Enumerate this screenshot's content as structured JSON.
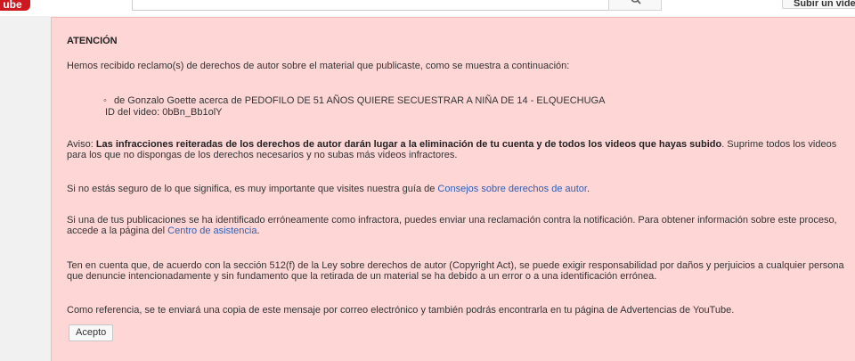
{
  "header": {
    "logo_text": "ube",
    "upload_label": "Subir un vídeo"
  },
  "notice": {
    "heading": "ATENCIÓN",
    "intro": "Hemos recibido reclamo(s) de derechos de autor sobre el material que publicaste, como se muestra a continuación:",
    "claim": "de Gonzalo Goette acerca de PEDOFILO DE 51  AÑOS QUIERE SECUESTRAR A NIÑA DE 14 - ELQUECHUGA",
    "video_id": "ID del video: 0bBn_Bb1olY",
    "warning_prefix": "Aviso: ",
    "warning_bold": "Las infracciones reiteradas de los derechos de autor darán lugar a la eliminación de tu cuenta y de todos los videos que hayas subido",
    "warning_rest": ". Suprime todos los videos para los que no dispongas de los derechos necesarios y no subas más videos infractores.",
    "unsure_text": "Si no estás seguro de lo que significa, es muy importante que visites nuestra guía de ",
    "unsure_link": "Consejos sobre derechos de autor",
    "unsure_end": ".",
    "dispute_text": "Si una de tus publicaciones se ha identificado erróneamente como infractora, puedes enviar una reclamación contra la notificación. Para obtener información sobre este proceso, accede a la página del ",
    "dispute_link": "Centro de asistencia",
    "dispute_end": ".",
    "legal_text": "Ten en cuenta que, de acuerdo con la sección 512(f) de la Ley sobre derechos de autor (Copyright Act), se puede exigir responsabilidad por daños y perjuicios a cualquier persona que denuncie intencionadamente y sin fundamento que la retirada de un material se ha debido a un error o a una identificación errónea.",
    "reference_text": "Como referencia, se te enviará una copia de este mensaje por correo electrónico y también podrás encontrarla en tu página de Advertencias de YouTube.",
    "accept_label": "Acepto"
  },
  "colors": {
    "notice_bg": "#ffd6d6",
    "link": "#2f5fb3",
    "brand": "#cc181e"
  }
}
